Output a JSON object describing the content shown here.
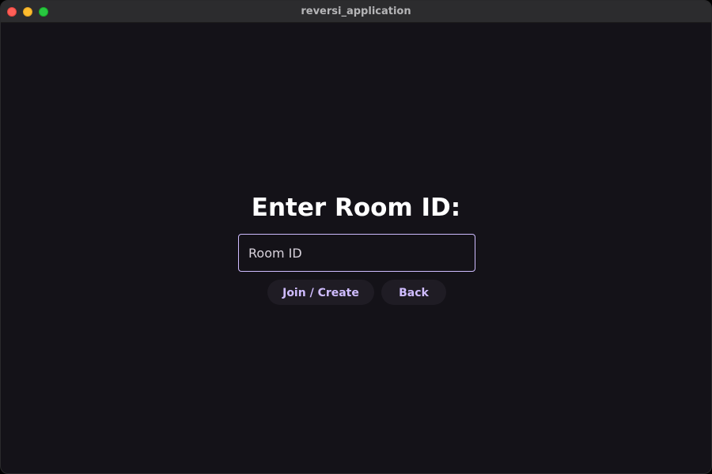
{
  "window": {
    "title": "reversi_application"
  },
  "main": {
    "heading": "Enter Room ID:",
    "room_input": {
      "value": "",
      "placeholder": "Room ID"
    },
    "buttons": {
      "join_create_label": "Join / Create",
      "back_label": "Back"
    }
  },
  "colors": {
    "background": "#141218",
    "accent": "#cfbcff",
    "button_bg": "#1f1c24",
    "heading_text": "#ffffff"
  }
}
